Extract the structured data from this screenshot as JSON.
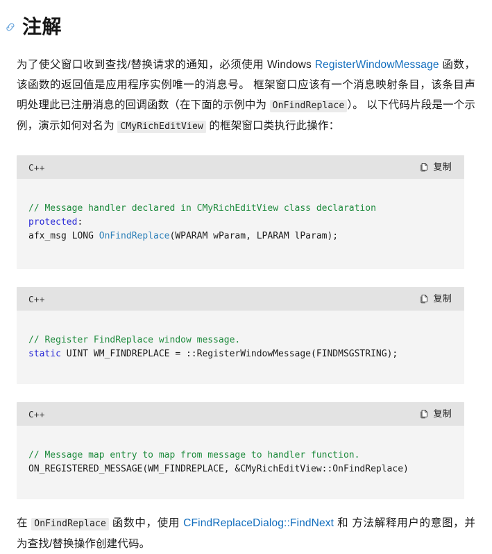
{
  "heading": {
    "anchor_icon": "link-anchor-icon",
    "title": "注解"
  },
  "intro_paragraph": {
    "part1": "为了使父窗口收到查找/替换请求的通知，必须使用 Windows ",
    "link1": "RegisterWindowMessage",
    "part2": " 函数，该函数的返回值是应用程序实例唯一的消息号。 框架窗口应该有一个消息映射条目，该条目声明处理此已注册消息的回调函数（在下面的示例中为 ",
    "code1": "OnFindReplace",
    "part3": "）。 以下代码片段是一个示例，演示如何对名为 ",
    "code2": "CMyRichEditView",
    "part4": " 的框架窗口类执行此操作："
  },
  "code_blocks": [
    {
      "language": "C++",
      "copy_label": "复制",
      "copy_icon": "copy-icon",
      "lines": [
        [
          {
            "text": "// Message handler declared in CMyRichEditView class declaration",
            "type": "comment"
          }
        ],
        [
          {
            "text": "protected",
            "type": "keyword"
          },
          {
            "text": ":",
            "type": "plain"
          }
        ],
        [
          {
            "text": "afx_msg LONG ",
            "type": "plain"
          },
          {
            "text": "OnFindReplace",
            "type": "fn"
          },
          {
            "text": "(WPARAM wParam, LPARAM lParam);",
            "type": "plain"
          }
        ]
      ]
    },
    {
      "language": "C++",
      "copy_label": "复制",
      "copy_icon": "copy-icon",
      "lines": [
        [
          {
            "text": "// Register FindReplace window message.",
            "type": "comment"
          }
        ],
        [
          {
            "text": "static",
            "type": "keyword"
          },
          {
            "text": " UINT WM_FINDREPLACE = ::RegisterWindowMessage(FINDMSGSTRING);",
            "type": "plain"
          }
        ]
      ]
    },
    {
      "language": "C++",
      "copy_label": "复制",
      "copy_icon": "copy-icon",
      "lines": [
        [
          {
            "text": "// Message map entry to map from message to handler function.",
            "type": "comment"
          }
        ],
        [
          {
            "text": "ON_REGISTERED_MESSAGE(WM_FINDREPLACE, &CMyRichEditView::OnFindReplace)",
            "type": "plain"
          }
        ]
      ]
    }
  ],
  "outro_paragraph": {
    "part1": "在 ",
    "code1": "OnFindReplace",
    "part2": " 函数中，使用 ",
    "link1": "CFindReplaceDialog::FindNext",
    "part3": " 和 方法解释用户的意图，并为查找/替换操作创建代码。"
  },
  "colors": {
    "link": "#0f6cbd",
    "comment": "#1d8a3c",
    "keyword": "#2727d6",
    "function": "#2b7fb8",
    "code_bg": "#f4f4f4",
    "code_header_bg": "#e3e3e3",
    "inline_code_bg": "#ebebeb",
    "text": "#1b1b1b"
  }
}
